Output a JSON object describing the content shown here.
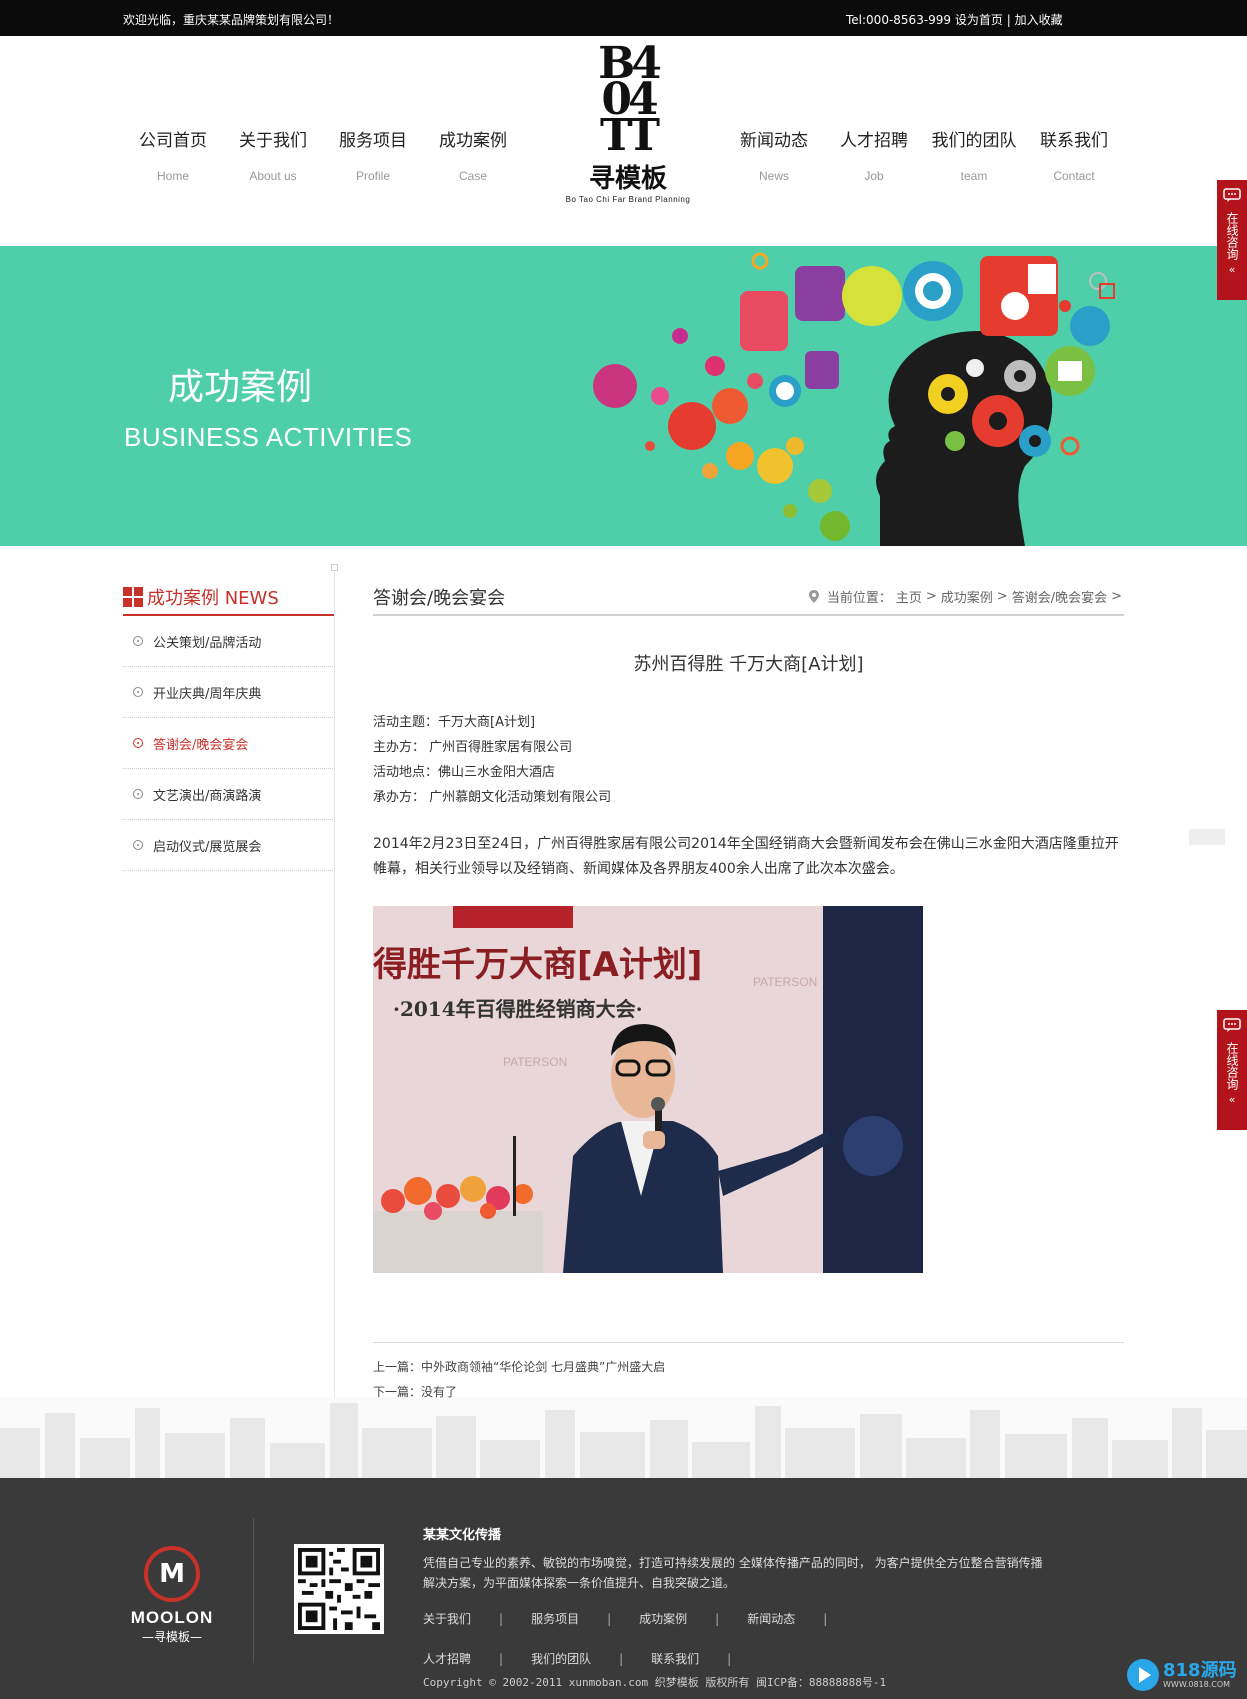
{
  "topbar": {
    "welcome": "欢迎光临，重庆某某品牌策划有限公司！",
    "tel": "Tel:000-8563-999",
    "set_home": "设为首页",
    "sep": "|",
    "favorite": "加入收藏"
  },
  "logo": {
    "mark_line1": "B4",
    "mark_line2": "04",
    "mark_line3": "TT",
    "name": "寻模板",
    "tagline": "Bo Tao Chi Far Brand Planning"
  },
  "nav": [
    {
      "cn": "公司首页",
      "en": "Home"
    },
    {
      "cn": "关于我们",
      "en": "About us"
    },
    {
      "cn": "服务项目",
      "en": "Profile"
    },
    {
      "cn": "成功案例",
      "en": "Case"
    },
    {
      "cn": "新闻动态",
      "en": "News"
    },
    {
      "cn": "人才招聘",
      "en": "Job"
    },
    {
      "cn": "我们的团队",
      "en": "team"
    },
    {
      "cn": "联系我们",
      "en": "Contact"
    }
  ],
  "banner": {
    "title": "成功案例",
    "subtitle": "BUSINESS ACTIVITIES",
    "accent": "#4fcfa9"
  },
  "sidebar": {
    "heading": "成功案例 NEWS",
    "items": [
      {
        "label": "公关策划/品牌活动",
        "active": false
      },
      {
        "label": "开业庆典/周年庆典",
        "active": false
      },
      {
        "label": "答谢会/晚会宴会",
        "active": true
      },
      {
        "label": "文艺演出/商演路演",
        "active": false
      },
      {
        "label": "启动仪式/展览展会",
        "active": false
      }
    ]
  },
  "main": {
    "section_title": "答谢会/晚会宴会",
    "breadcrumb": {
      "label": "当前位置：",
      "items": [
        "主页",
        "成功案例",
        "答谢会/晚会宴会"
      ],
      "sep": ">"
    },
    "article_title": "苏州百得胜 千万大商[A计划]",
    "meta": [
      "活动主题：千万大商[A计划]",
      "主办方：  广州百得胜家居有限公司",
      "活动地点：佛山三水金阳大酒店",
      "承办方：  广州慕朗文化活动策划有限公司"
    ],
    "body": "2014年2月23日至24日，广州百得胜家居有限公司2014年全国经销商大会暨新闻发布会在佛山三水金阳大酒店隆重拉开帷幕，相关行业领导以及经销商、新闻媒体及各界朋友400余人出席了此次本次盛会。",
    "photo_text1": "得胜千万大商[A计划]",
    "photo_text2": "·2014年百得胜经销商大会·",
    "photo_brand": "PATERSON",
    "prev_label": "上一篇：",
    "prev_title": "中外政商领袖“华伦论剑 七月盛典”广州盛大启",
    "next_label": "下一篇：",
    "next_title": "没有了"
  },
  "footer": {
    "brand": "MOOLON",
    "brand_cn": "—寻模板—",
    "company": "某某文化传播",
    "desc": "凭借自己专业的素养、敏锐的市场嗅觉，打造可持续发展的 全媒体传播产品的同时， 为客户提供全方位整合营销传播解决方案，为平面媒体探索一条价值提升、自我突破之道。",
    "links": [
      "关于我们",
      "服务项目",
      "成功案例",
      "新闻动态",
      "人才招聘",
      "我们的团队",
      "联系我们"
    ],
    "copyright": "Copyright © 2002-2011 xunmoban.com 织梦模板 版权所有 闽ICP备：88888888号-1"
  },
  "consult": {
    "label": "在线咨询",
    "arrow": "«"
  },
  "watermark": {
    "line1": "818源码",
    "line2": "WWW.0818.COM"
  },
  "colors": {
    "primary_red": "#c8322b",
    "teal": "#4fcfa9",
    "footer_bg": "#3a3a3a"
  }
}
